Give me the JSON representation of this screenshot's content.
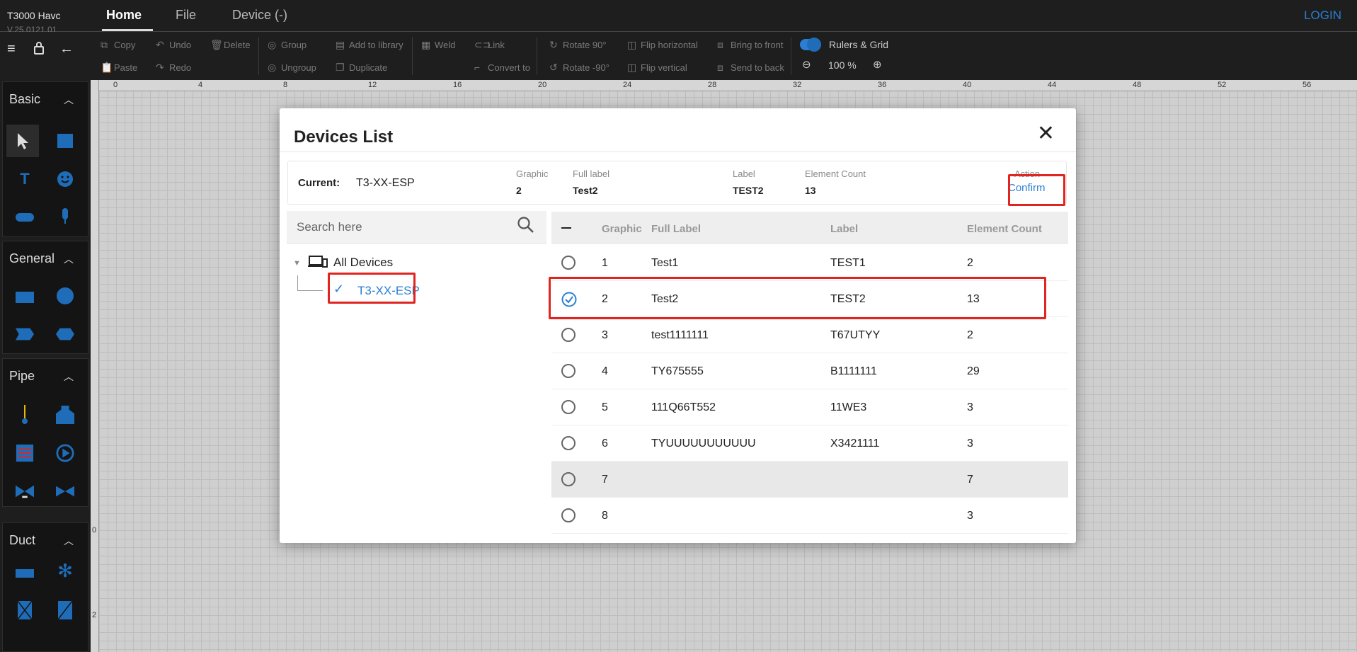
{
  "app": {
    "title": "T3000 Havc",
    "version": "V.25.0121.01",
    "login": "LOGIN"
  },
  "tabs": [
    {
      "label": "Home"
    },
    {
      "label": "File"
    },
    {
      "label": "Device (-)"
    }
  ],
  "toolbar": {
    "copy": "Copy",
    "paste": "Paste",
    "undo": "Undo",
    "redo": "Redo",
    "delete": "Delete",
    "group": "Group",
    "ungroup": "Ungroup",
    "add_library": "Add to library",
    "duplicate": "Duplicate",
    "weld": "Weld",
    "link": "Link",
    "convert": "Convert to",
    "rotate90": "Rotate 90°",
    "rotate_neg90": "Rotate -90°",
    "flip_h": "Flip horizontal",
    "flip_v": "Flip vertical",
    "bring_front": "Bring to front",
    "send_back": "Send to back",
    "rulers_grid": "Rulers & Grid",
    "zoom": "100 %"
  },
  "sidebar": {
    "panels": [
      {
        "title": "Basic"
      },
      {
        "title": "General"
      },
      {
        "title": "Pipe"
      },
      {
        "title": "Duct"
      }
    ]
  },
  "ruler": {
    "h": [
      "0",
      "4",
      "8",
      "12",
      "16",
      "20",
      "24",
      "28",
      "32",
      "36",
      "40",
      "44",
      "48",
      "52",
      "56"
    ],
    "v": [
      "0",
      "2"
    ]
  },
  "modal": {
    "title": "Devices List",
    "current": {
      "label": "Current:",
      "device": "T3-XX-ESP",
      "h_graphic": "Graphic",
      "graphic": "2",
      "h_full": "Full label",
      "full": "Test2",
      "h_label": "Label",
      "label_val": "TEST2",
      "h_count": "Element Count",
      "count": "13",
      "h_action": "Action",
      "confirm": "Confirm"
    },
    "search_placeholder": "Search here",
    "tree": {
      "root": "All Devices",
      "leaf": "T3-XX-ESP"
    },
    "columns": {
      "graphic": "Graphic",
      "full": "Full Label",
      "label": "Label",
      "count": "Element Count"
    },
    "rows": [
      {
        "g": "1",
        "f": "Test1",
        "l": "TEST1",
        "c": "2"
      },
      {
        "g": "2",
        "f": "Test2",
        "l": "TEST2",
        "c": "13"
      },
      {
        "g": "3",
        "f": "test1111111",
        "l": "T67UTYY",
        "c": "2"
      },
      {
        "g": "4",
        "f": "TY675555",
        "l": "B1111111",
        "c": "29"
      },
      {
        "g": "5",
        "f": "111Q66T552",
        "l": "11WE3",
        "c": "3"
      },
      {
        "g": "6",
        "f": "TYUUUUUUUUUUU",
        "l": "X3421111",
        "c": "3"
      },
      {
        "g": "7",
        "f": "",
        "l": "",
        "c": "7"
      },
      {
        "g": "8",
        "f": "",
        "l": "",
        "c": "3"
      }
    ]
  },
  "colors": {
    "accent": "#2a7fd4",
    "highlight": "#e0241f"
  }
}
